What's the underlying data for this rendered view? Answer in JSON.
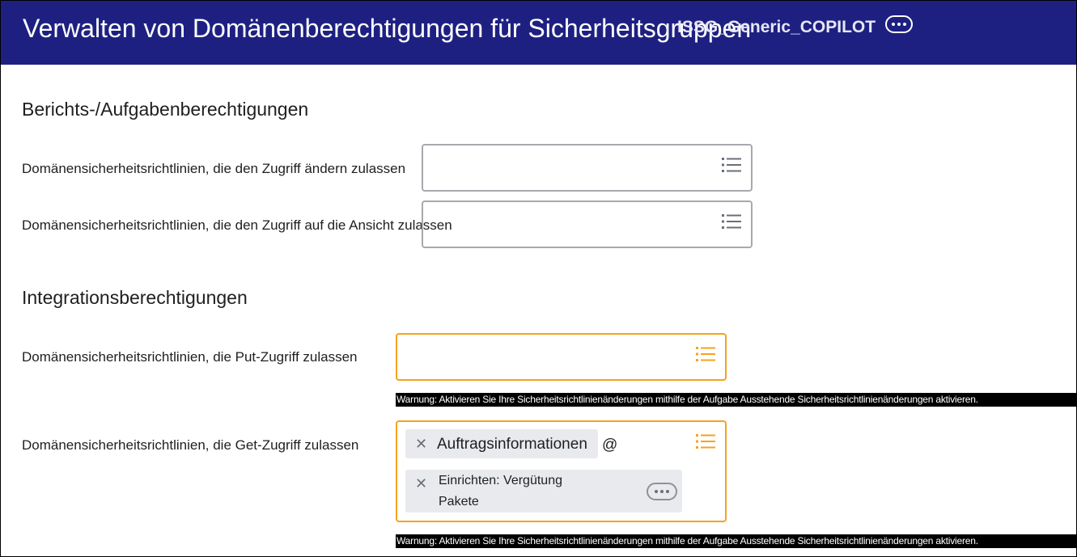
{
  "header": {
    "title": "Verwalten von Domänenberechtigungen für Sicherheitsgruppen",
    "group_name": "ISSG_Generic_COPILOT",
    "more_icon": "more-horizontal-icon"
  },
  "colors": {
    "header_bg": "#1e2081",
    "warning_border": "#f6a21d",
    "default_border": "#a7a9ae",
    "warning_bar_bg": "#000000"
  },
  "sections": [
    {
      "title": "Berichts-/Aufgabenberechtigungen",
      "fields": [
        {
          "label": "Domänensicherheitsrichtlinien, die den Zugriff ändern zulassen",
          "values": []
        },
        {
          "label": "Domänensicherheitsrichtlinien, die den Zugriff auf die Ansicht zulassen",
          "values": []
        }
      ]
    },
    {
      "title": "Integrationsberechtigungen",
      "fields": [
        {
          "label": "Domänensicherheitsrichtlinien, die Put-Zugriff zulassen",
          "values": [],
          "warning": "Warnung: Aktivieren Sie Ihre Sicherheitsrichtlinienänderungen mithilfe der Aufgabe Ausstehende Sicherheitsrichtlinienänderungen aktivieren."
        },
        {
          "label": "Domänensicherheitsrichtlinien, die Get-Zugriff zulassen",
          "values": [
            {
              "text": "Auftragsinformationen",
              "suffix": "@"
            },
            {
              "line1": "Einrichten: Vergütung",
              "line2": "Pakete"
            }
          ],
          "warning": "Warnung: Aktivieren Sie Ihre Sicherheitsrichtlinienänderungen mithilfe der Aufgabe Ausstehende Sicherheitsrichtlinienänderungen aktivieren."
        }
      ]
    }
  ],
  "icons": {
    "prompt": "list-icon",
    "remove": "close-icon",
    "related_actions": "more-horizontal-icon"
  },
  "glyphs": {
    "remove": "✕"
  }
}
